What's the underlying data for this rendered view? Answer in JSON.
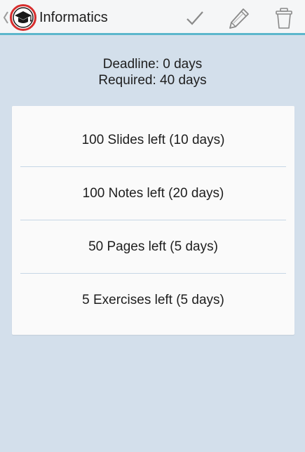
{
  "header": {
    "title": "Informatics",
    "actions": [
      "check-icon",
      "pencil-icon",
      "trash-icon"
    ]
  },
  "summary": {
    "deadline": "Deadline: 0 days",
    "required": "Required: 40 days"
  },
  "tasks": [
    {
      "label": "100 Slides left (10 days)"
    },
    {
      "label": "100 Notes left (20 days)"
    },
    {
      "label": "50 Pages left (5 days)"
    },
    {
      "label": "5 Exercises left (5 days)"
    }
  ],
  "colors": {
    "background": "#d3dfeb",
    "action_bar": "#f5f6f7",
    "accent": "#5cb7cc",
    "logo_ring": "#d62d2d",
    "icon": "#8a8a8a"
  }
}
